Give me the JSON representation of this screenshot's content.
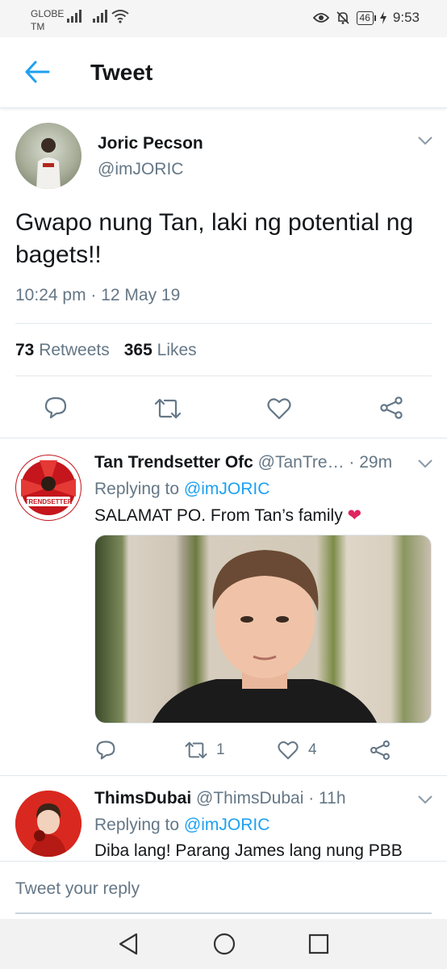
{
  "status_bar": {
    "carrier_line1": "GLOBE",
    "carrier_line2": "TM",
    "battery": "46",
    "time": "9:53",
    "icons": [
      "signal-icon",
      "wifi-icon",
      "eye-icon",
      "bell-off-icon",
      "battery-icon",
      "charging-icon"
    ]
  },
  "header": {
    "title": "Tweet",
    "back_icon": "arrow-left-icon"
  },
  "tweet": {
    "author_name": "Joric Pecson",
    "author_handle": "@imJORIC",
    "text": "Gwapo nung Tan, laki ng potential ng bagets!!",
    "timestamp": "10:24 pm · 12 May 19",
    "retweets_count": "73",
    "retweets_label": "Retweets",
    "likes_count": "365",
    "likes_label": "Likes",
    "actions": [
      "reply-icon",
      "retweet-icon",
      "like-icon",
      "share-icon"
    ]
  },
  "replies": [
    {
      "name": "Tan Trendsetter Ofc",
      "meta": "@TanTre… · 29m",
      "replying_prefix": "Replying to",
      "replying_to": "@imJORIC",
      "text": "SALAMAT PO. From Tan’s family",
      "emoji": "❤",
      "avatar_text": "TRENDSETTER",
      "retweets": "1",
      "likes": "4"
    },
    {
      "name": "ThimsDubai",
      "meta": "@ThimsDubai · 11h",
      "replying_prefix": "Replying to",
      "replying_to": "@imJORIC",
      "text": "Diba lang! Parang James lang nung PBB"
    }
  ],
  "reply_bar": {
    "placeholder": "Tweet your reply"
  },
  "colors": {
    "accent": "#1da1f2",
    "secondary_text": "#657786",
    "like": "#e0245e"
  }
}
